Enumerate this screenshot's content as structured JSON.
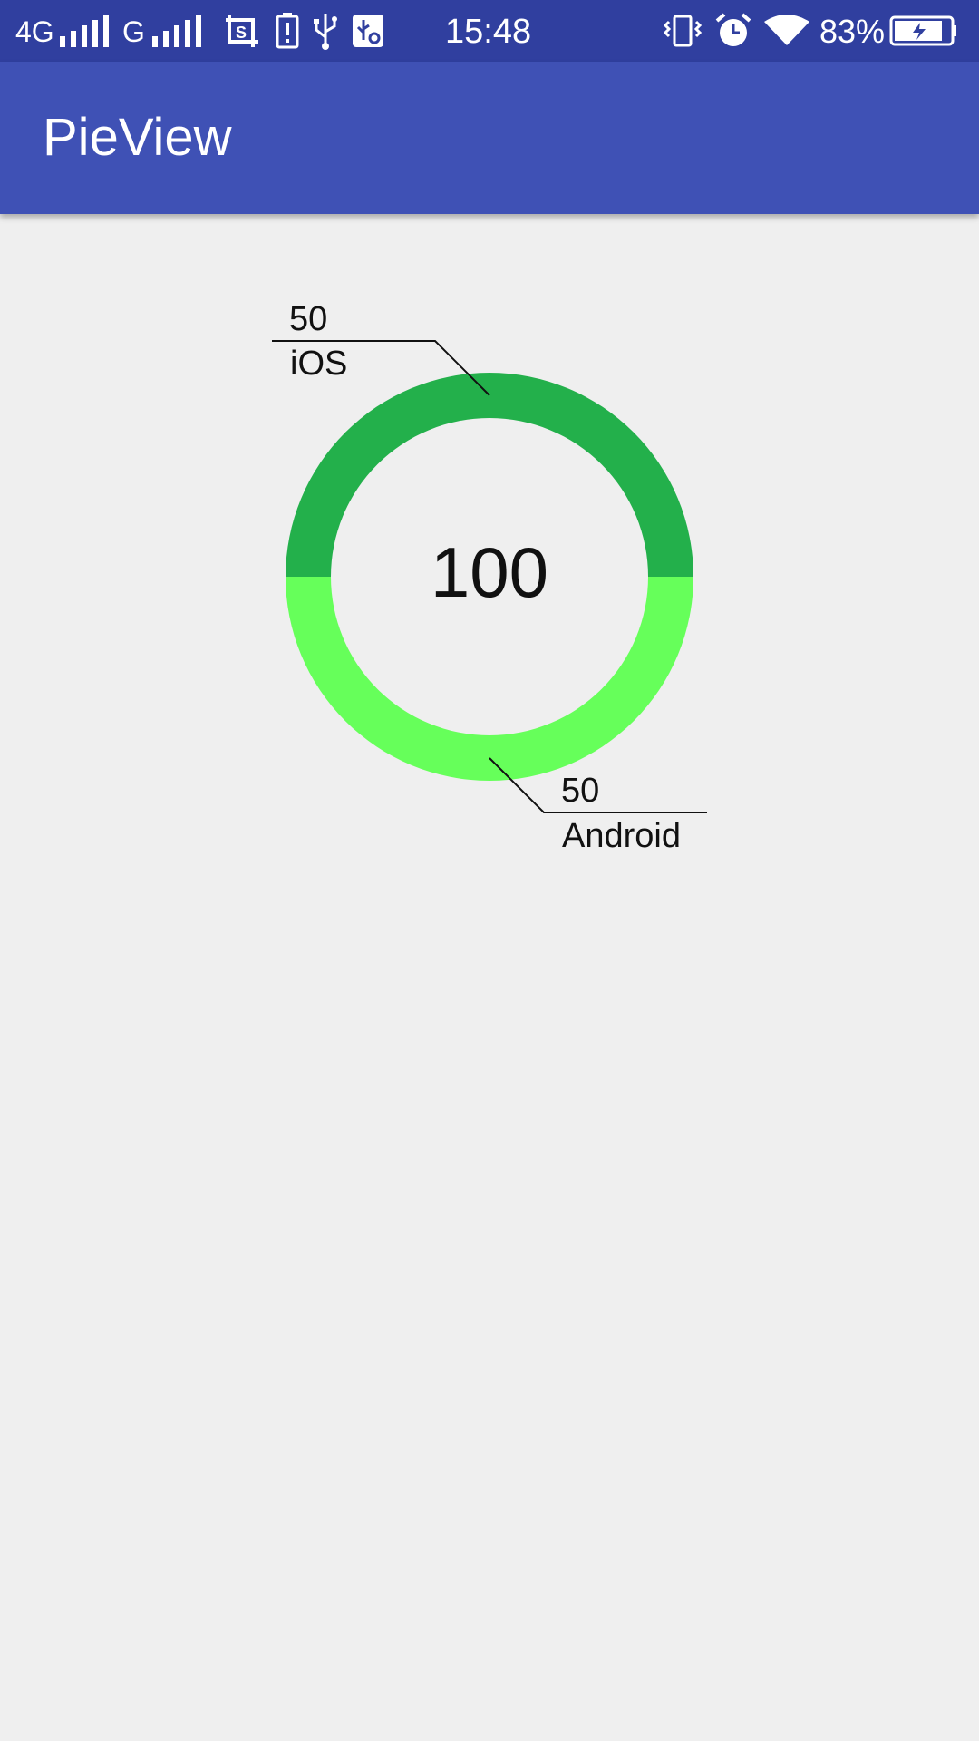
{
  "status_bar": {
    "network": "4G",
    "network2": "G",
    "time": "15:48",
    "battery": "83%",
    "battery_level": 0.83,
    "icons": [
      "signal-icon",
      "screenshot-icon",
      "alert-icon",
      "usb-icon",
      "usb-debug-icon",
      "vibrate-icon",
      "alarm-icon",
      "wifi-icon",
      "battery-charging-icon"
    ]
  },
  "app_bar": {
    "title": "PieView"
  },
  "chart_data": {
    "type": "pie",
    "variant": "donut",
    "total_label": "100",
    "slices": [
      {
        "label": "iOS",
        "value": 50,
        "value_label": "50",
        "color": "#23b04b"
      },
      {
        "label": "Android",
        "value": 50,
        "value_label": "50",
        "color": "#66ff5a"
      }
    ]
  }
}
